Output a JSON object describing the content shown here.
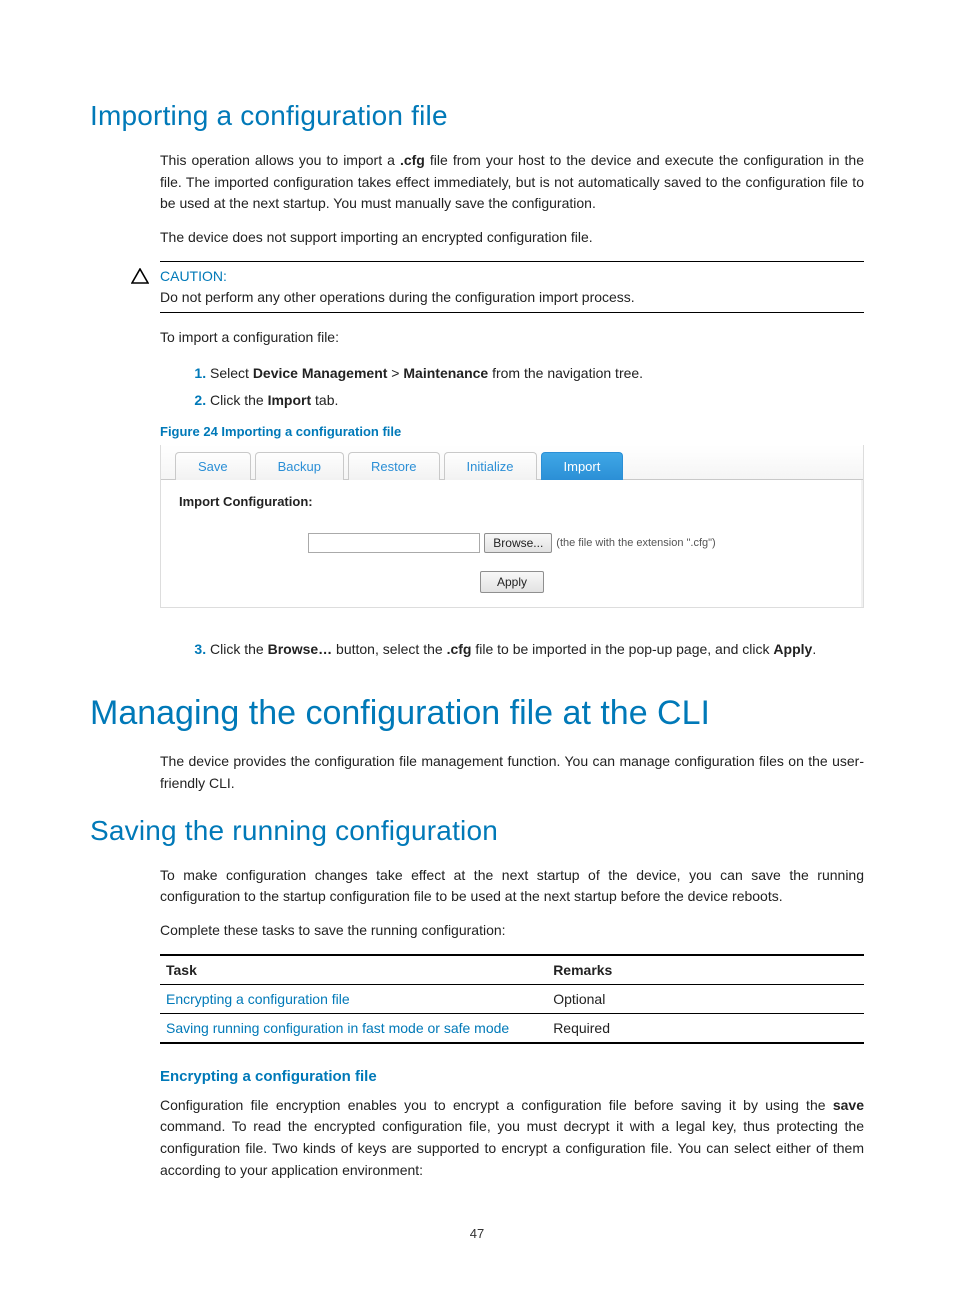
{
  "section1": {
    "title": "Importing a configuration file",
    "p1_a": "This operation allows you to import a ",
    "p1_b": ".cfg",
    "p1_c": " file from your host to the device and execute the configuration in the file. The imported configuration takes effect immediately, but is not automatically saved to the configuration file to be used at the next startup. You must manually save the configuration.",
    "p2": "The device does not support importing an encrypted configuration file.",
    "caution_label": "CAUTION:",
    "caution_text": "Do not perform any other operations during the configuration import process.",
    "intro": "To import a configuration file:",
    "step1_a": "Select ",
    "step1_b": "Device Management",
    "step1_c": " > ",
    "step1_d": "Maintenance",
    "step1_e": " from the navigation tree.",
    "step2_a": "Click the ",
    "step2_b": "Import",
    "step2_c": " tab.",
    "fig_caption": "Figure 24 Importing a configuration file",
    "step3_a": "Click the ",
    "step3_b": "Browse…",
    "step3_c": " button, select the ",
    "step3_d": ".cfg",
    "step3_e": " file to be imported in the pop-up page, and click ",
    "step3_f": "Apply",
    "step3_g": "."
  },
  "shot": {
    "tabs": [
      "Save",
      "Backup",
      "Restore",
      "Initialize",
      "Import"
    ],
    "panel_label": "Import Configuration:",
    "browse_btn": "Browse...",
    "hint": "(the file with the extension \".cfg\")",
    "apply_btn": "Apply"
  },
  "section2": {
    "title": "Managing the configuration file at the CLI",
    "p1": "The device provides the configuration file management function. You can manage configuration files on the user-friendly CLI."
  },
  "section3": {
    "title": "Saving the running configuration",
    "p1": "To make configuration changes take effect at the next startup of the device, you can save the running configuration to the startup configuration file to be used at the next startup before the device reboots.",
    "p2": "Complete these tasks to save the running configuration:",
    "table": {
      "headers": [
        "Task",
        "Remarks"
      ],
      "rows": [
        {
          "task": "Encrypting a configuration file",
          "remarks": "Optional"
        },
        {
          "task": "Saving running configuration in fast mode or safe mode",
          "remarks": "Required"
        }
      ]
    },
    "sub_h": "Encrypting a configuration file",
    "p3_a": "Configuration file encryption enables you to encrypt a configuration file before saving it by using the ",
    "p3_b": "save",
    "p3_c": " command. To read the encrypted configuration file, you must decrypt it with a legal key, thus protecting the configuration file. Two kinds of keys are supported to encrypt a configuration file. You can select either of them according to your application environment:"
  },
  "page_number": "47"
}
